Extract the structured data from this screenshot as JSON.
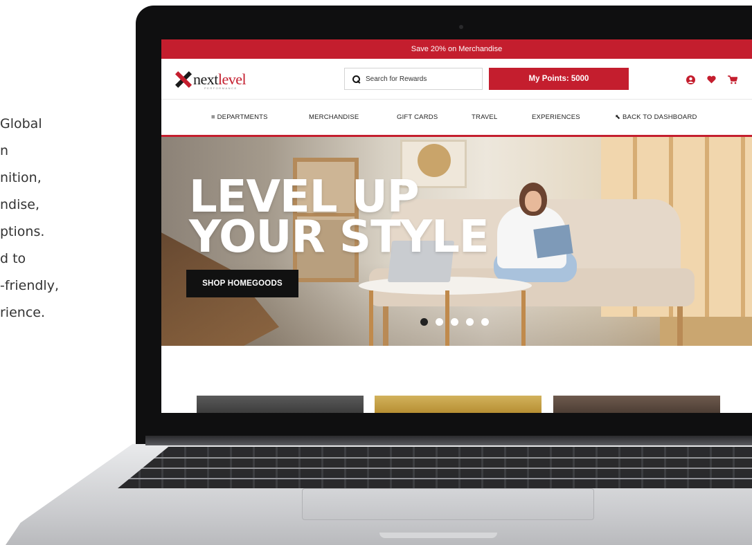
{
  "side_text": {
    "lines": [
      "Global",
      "n",
      "nition,",
      "ndise,",
      "ptions.",
      "d to",
      "-friendly,",
      "rience."
    ]
  },
  "site": {
    "promo_text": "Save 20% on Merchandise",
    "logo": {
      "part1": "next",
      "part2": "level",
      "tagline": "PERFORMANCE"
    },
    "search_placeholder": "Search for Rewards",
    "points_label": "My Points: 5000",
    "header_icons": [
      "user-icon",
      "heart-icon",
      "cart-icon"
    ],
    "nav": {
      "departments": "DEPARTMENTS",
      "merchandise": "MERCHANDISE",
      "gift_cards": "GIFT CARDS",
      "travel": "TRAVEL",
      "experiences": "EXPERIENCES",
      "back": "BACK TO DASHBOARD"
    },
    "hero": {
      "title_line1": "LEVEL UP",
      "title_line2": "YOUR STYLE",
      "button": "SHOP HOMEGOODS",
      "slide_count": 5,
      "active_slide": 1
    }
  },
  "colors": {
    "brand_red": "#c41e2e",
    "dark": "#111111",
    "white": "#ffffff"
  }
}
